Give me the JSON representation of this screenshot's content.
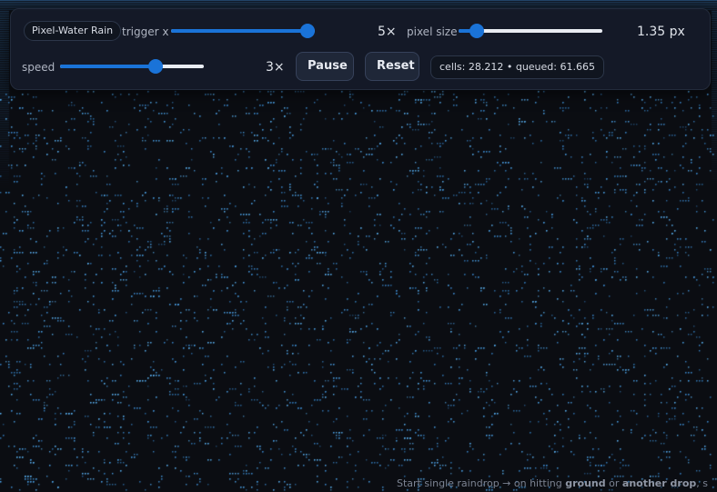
{
  "app": {
    "title": "Pixel-Water Rain"
  },
  "controls": {
    "trigger": {
      "label": "trigger x",
      "value": 5,
      "min": 1,
      "max": 5,
      "value_text": "5×"
    },
    "pixel_size": {
      "label": "pixel size",
      "value": 1.35,
      "min": 1,
      "max": 5,
      "value_text": "1.35 px"
    },
    "speed": {
      "label": "speed",
      "value": 3,
      "min": 0,
      "max": 4.4,
      "value_text": "3×"
    },
    "pause_label": "Pause",
    "reset_label": "Reset"
  },
  "status": {
    "text": "cells: 28.212 • queued: 61.665"
  },
  "footer": {
    "prefix": "Start single raindrop → on hitting ",
    "bold1": "ground",
    "middle": " or ",
    "bold2": "another drop",
    "suffix": ", s"
  },
  "colors": {
    "background": "#0b0d12",
    "drop": "#4a9fe4",
    "accent": "#1a73d8"
  }
}
